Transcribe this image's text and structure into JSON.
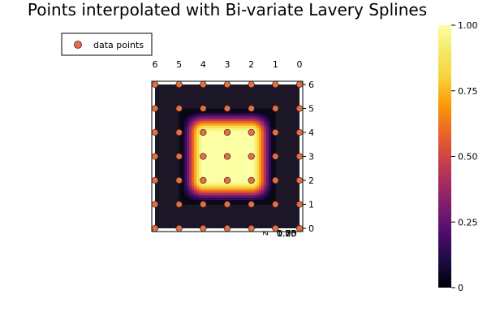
{
  "chart_data": {
    "type": "heatmap",
    "title": "Points interpolated with Bi-variate Lavery Splines",
    "legend": {
      "entries": [
        "data points"
      ],
      "position": "top-left"
    },
    "x_ticks": [
      "6",
      "5",
      "4",
      "3",
      "2",
      "1",
      "0"
    ],
    "y_ticks": [
      "6",
      "5",
      "4",
      "3",
      "2",
      "1",
      "0"
    ],
    "z_axis": {
      "label": "z",
      "tick_labels_overlapping": [
        "0.00",
        "0.25",
        "0.50",
        "0.75",
        "1.00"
      ]
    },
    "xlim": [
      0,
      6
    ],
    "ylim": [
      0,
      6
    ],
    "colorbar": {
      "colormap": "inferno",
      "range": [
        0,
        1
      ],
      "ticks": [
        "0",
        "0.25",
        "0.50",
        "0.75",
        "1.00"
      ],
      "tick_values": [
        0,
        0.25,
        0.5,
        0.75,
        1.0
      ]
    },
    "surface": {
      "description_value": "1 on inner region [2,4]x[2,4], 0 outside [1,5]x[1,5], smooth transition",
      "plateau": [
        2,
        4
      ],
      "support": [
        1,
        5
      ]
    },
    "data_points": [
      {
        "x": 0,
        "y": 0,
        "z": 0
      },
      {
        "x": 1,
        "y": 0,
        "z": 0
      },
      {
        "x": 2,
        "y": 0,
        "z": 0
      },
      {
        "x": 3,
        "y": 0,
        "z": 0
      },
      {
        "x": 4,
        "y": 0,
        "z": 0
      },
      {
        "x": 5,
        "y": 0,
        "z": 0
      },
      {
        "x": 6,
        "y": 0,
        "z": 0
      },
      {
        "x": 0,
        "y": 1,
        "z": 0
      },
      {
        "x": 1,
        "y": 1,
        "z": 0
      },
      {
        "x": 2,
        "y": 1,
        "z": 0
      },
      {
        "x": 3,
        "y": 1,
        "z": 0
      },
      {
        "x": 4,
        "y": 1,
        "z": 0
      },
      {
        "x": 5,
        "y": 1,
        "z": 0
      },
      {
        "x": 6,
        "y": 1,
        "z": 0
      },
      {
        "x": 0,
        "y": 2,
        "z": 0
      },
      {
        "x": 1,
        "y": 2,
        "z": 0
      },
      {
        "x": 2,
        "y": 2,
        "z": 1
      },
      {
        "x": 3,
        "y": 2,
        "z": 1
      },
      {
        "x": 4,
        "y": 2,
        "z": 1
      },
      {
        "x": 5,
        "y": 2,
        "z": 0
      },
      {
        "x": 6,
        "y": 2,
        "z": 0
      },
      {
        "x": 0,
        "y": 3,
        "z": 0
      },
      {
        "x": 1,
        "y": 3,
        "z": 0
      },
      {
        "x": 2,
        "y": 3,
        "z": 1
      },
      {
        "x": 3,
        "y": 3,
        "z": 1
      },
      {
        "x": 4,
        "y": 3,
        "z": 1
      },
      {
        "x": 5,
        "y": 3,
        "z": 0
      },
      {
        "x": 6,
        "y": 3,
        "z": 0
      },
      {
        "x": 0,
        "y": 4,
        "z": 0
      },
      {
        "x": 1,
        "y": 4,
        "z": 0
      },
      {
        "x": 2,
        "y": 4,
        "z": 1
      },
      {
        "x": 3,
        "y": 4,
        "z": 1
      },
      {
        "x": 4,
        "y": 4,
        "z": 1
      },
      {
        "x": 5,
        "y": 4,
        "z": 0
      },
      {
        "x": 6,
        "y": 4,
        "z": 0
      },
      {
        "x": 0,
        "y": 5,
        "z": 0
      },
      {
        "x": 1,
        "y": 5,
        "z": 0
      },
      {
        "x": 2,
        "y": 5,
        "z": 0
      },
      {
        "x": 3,
        "y": 5,
        "z": 0
      },
      {
        "x": 4,
        "y": 5,
        "z": 0
      },
      {
        "x": 5,
        "y": 5,
        "z": 0
      },
      {
        "x": 6,
        "y": 5,
        "z": 0
      },
      {
        "x": 0,
        "y": 6,
        "z": 0
      },
      {
        "x": 1,
        "y": 6,
        "z": 0
      },
      {
        "x": 2,
        "y": 6,
        "z": 0
      },
      {
        "x": 3,
        "y": 6,
        "z": 0
      },
      {
        "x": 4,
        "y": 6,
        "z": 0
      },
      {
        "x": 5,
        "y": 6,
        "z": 0
      },
      {
        "x": 6,
        "y": 6,
        "z": 0
      }
    ],
    "colors": {
      "marker_fill": "#e26f46",
      "marker_stroke": "#3a1f14"
    }
  }
}
